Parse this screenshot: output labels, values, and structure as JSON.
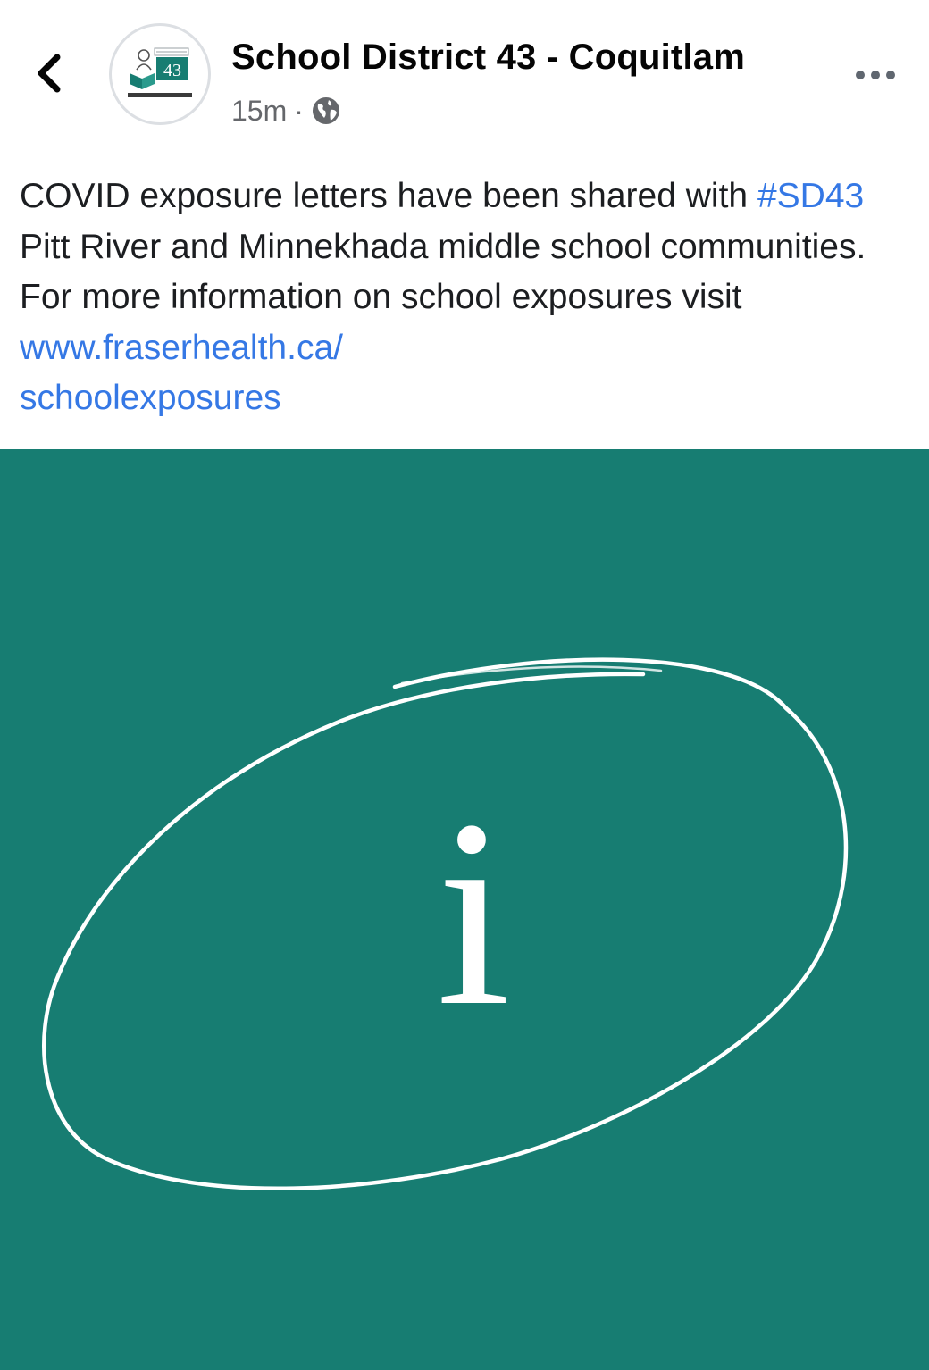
{
  "post": {
    "page_name": "School District 43 - Coquitlam",
    "timestamp": "15m",
    "separator": "·",
    "audience_icon": "globe-icon",
    "text_part1": "COVID exposure letters have been shared with",
    "hashtag": "#SD43",
    "text_part2": "Pitt River and Minnekhada middle school communities. For more information on school exposures visit",
    "link_line1": "www.fraserhealth.ca/",
    "link_line2": "schoolexposures"
  },
  "avatar": {
    "logo_number": "43"
  },
  "image": {
    "background_color": "#177d72",
    "glyph": "i",
    "icon": "info-circle-icon"
  },
  "icons": {
    "back": "chevron-left-icon",
    "more": "more-horizontal-icon"
  },
  "colors": {
    "link": "#3578e5",
    "secondary_text": "#65676b"
  }
}
